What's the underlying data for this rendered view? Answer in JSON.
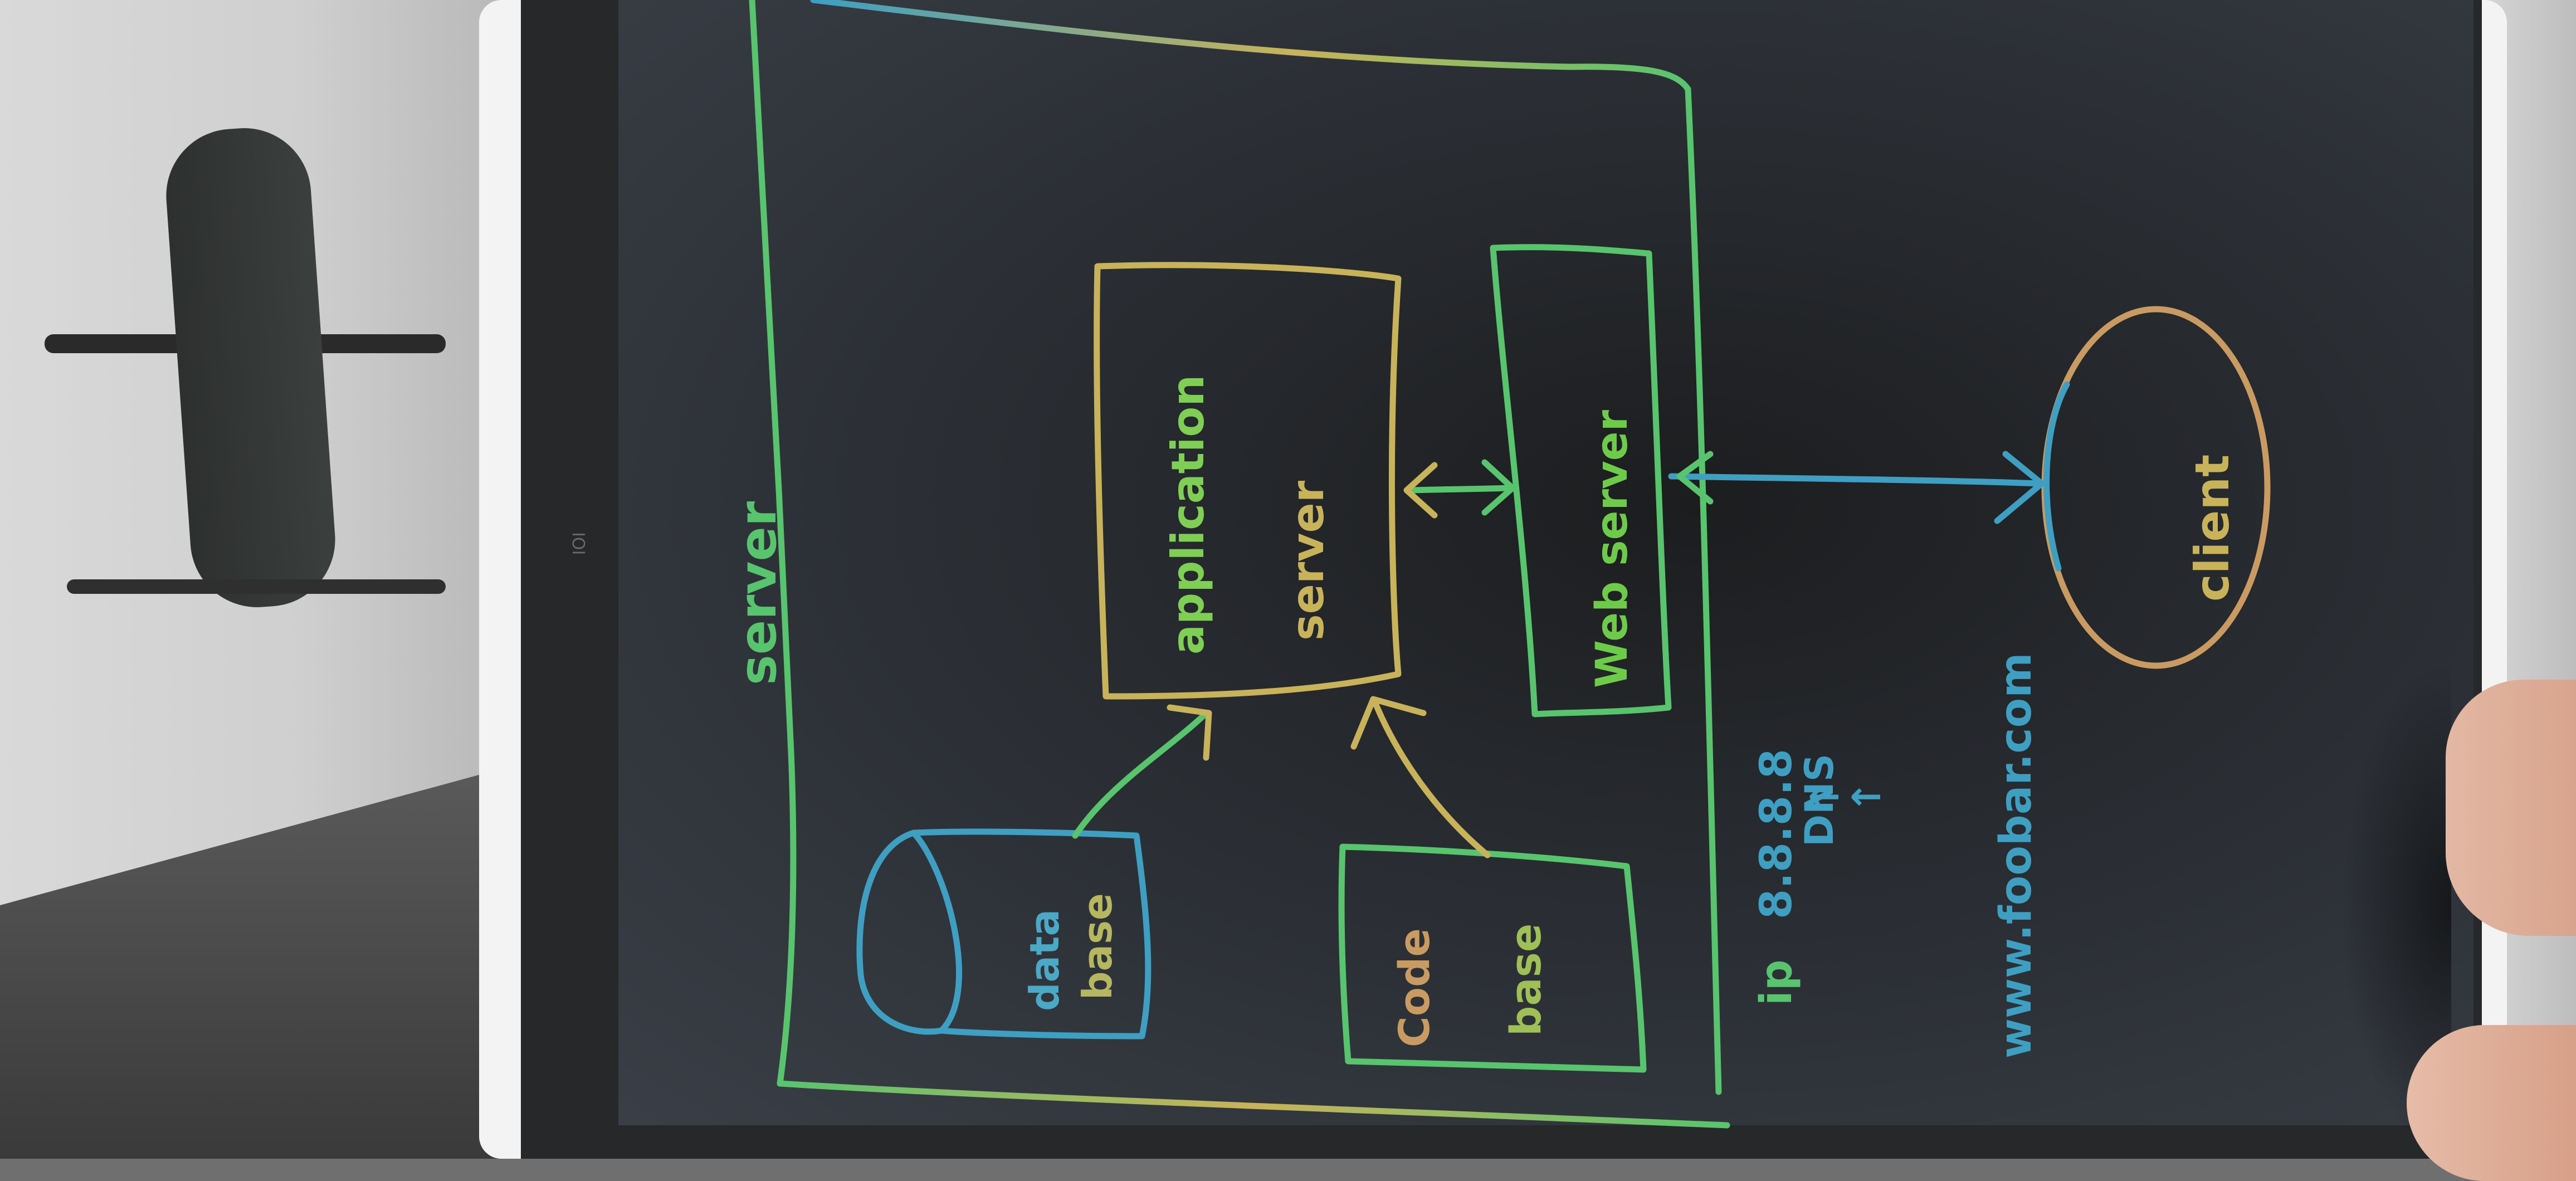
{
  "diagram": {
    "container_label": "server",
    "nodes": {
      "application_server": [
        "application",
        "server"
      ],
      "web_server": "Web server",
      "database": [
        "data",
        "base"
      ],
      "code_base": [
        "Code",
        "base"
      ],
      "client": "client"
    },
    "dns_chain": {
      "ip_prefix": "ip",
      "ip": "8.8.8.8",
      "up_arrow": "↑",
      "dns": "DNS",
      "domain": "www.foobar.com"
    },
    "edges": [
      {
        "from": "web_server",
        "to": "application_server",
        "style": "bidirectional"
      },
      {
        "from": "database",
        "to": "application_server",
        "style": "directed"
      },
      {
        "from": "code_base",
        "to": "application_server",
        "style": "directed"
      },
      {
        "from": "web_server",
        "to": "client",
        "style": "bidirectional"
      }
    ],
    "colors": {
      "green": "#58c46e",
      "yellow": "#c8b35a",
      "blue": "#3e9fc2",
      "orange": "#c99b62",
      "screen": "#2c3036"
    }
  },
  "device_logo": "IOI"
}
